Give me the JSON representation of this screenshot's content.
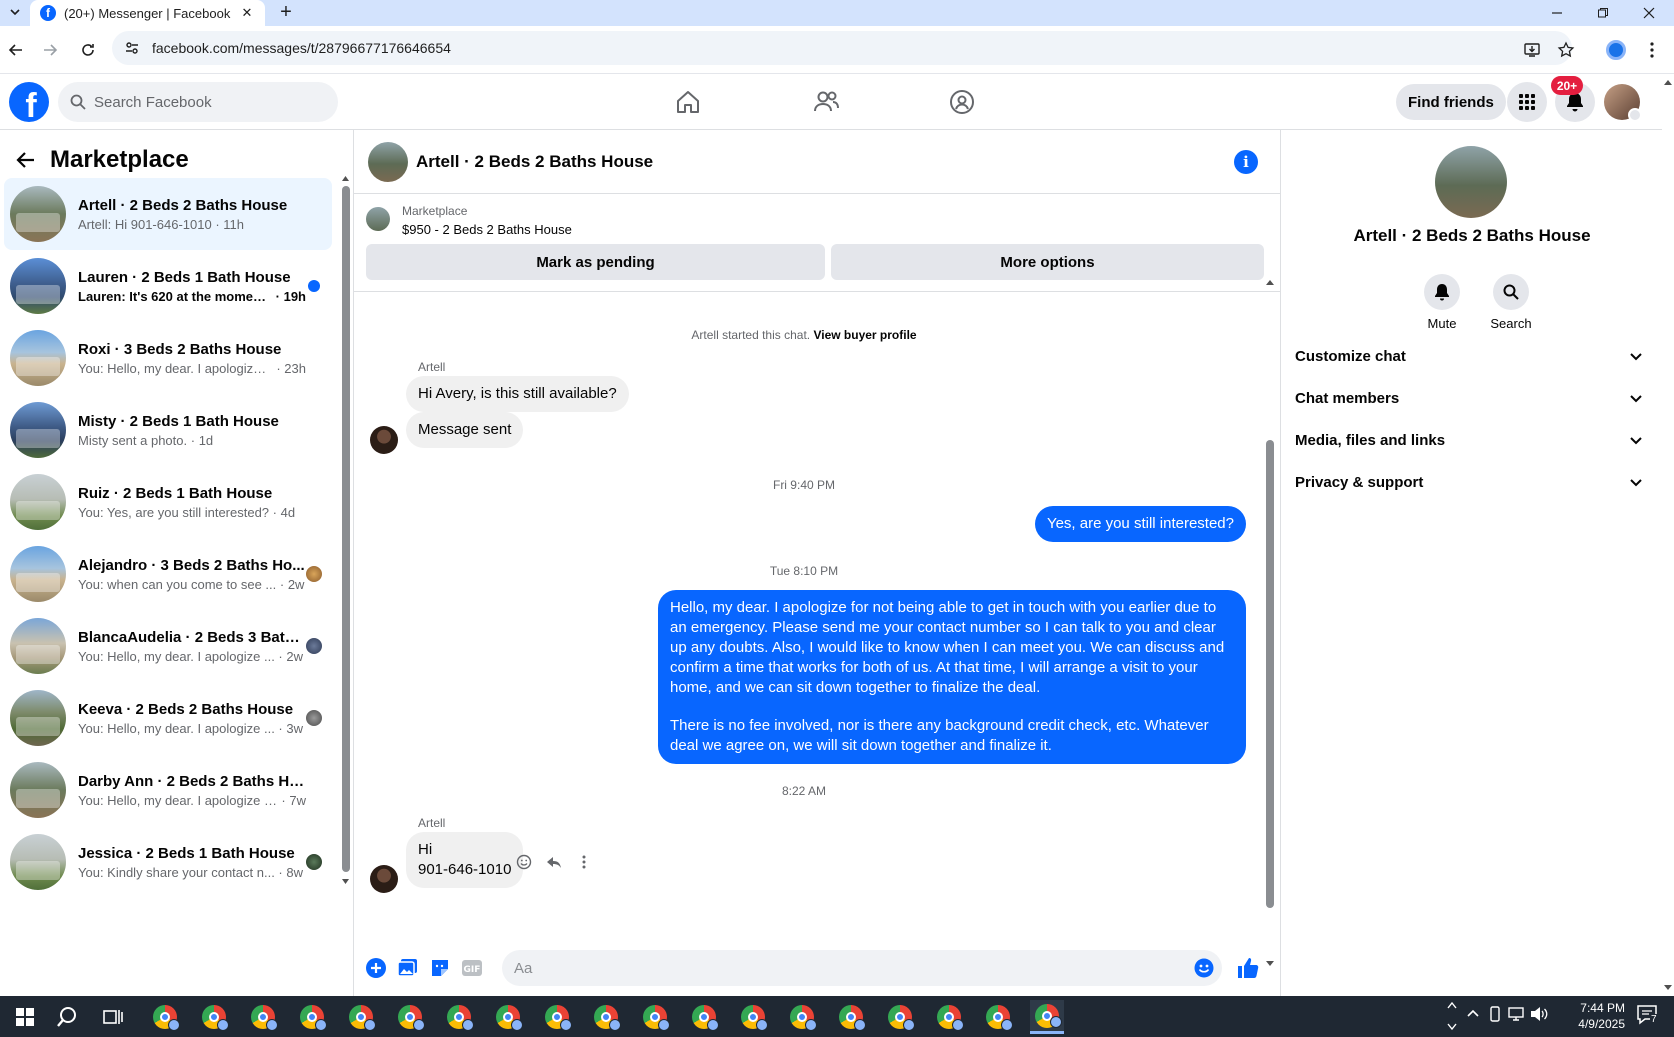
{
  "browser": {
    "tab_title": "(20+) Messenger | Facebook",
    "url": "facebook.com/messages/t/28796677176646654"
  },
  "header": {
    "search_placeholder": "Search Facebook",
    "find_friends": "Find friends",
    "notification_badge": "20+"
  },
  "sidebar": {
    "title": "Marketplace",
    "conversations": [
      {
        "name": "Artell · 2 Beds 2 Baths House",
        "preview": "Artell: Hi 901-646-1010",
        "time": "11h",
        "active": true
      },
      {
        "name": "Lauren · 2 Beds 1 Bath House",
        "preview": "Lauren: It's 620 at the moment....",
        "time": "19h",
        "unread": true
      },
      {
        "name": "Roxi · 3 Beds 2 Baths House",
        "preview": "You: Hello, my dear. I apologize fo...",
        "time": "23h"
      },
      {
        "name": "Misty · 2 Beds 1 Bath House",
        "preview": "Misty sent a photo.",
        "time": "1d"
      },
      {
        "name": "Ruiz · 2 Beds 1 Bath House",
        "preview": "You: Yes, are you still interested?",
        "time": "4d"
      },
      {
        "name": "Alejandro · 3 Beds 2 Baths Ho...",
        "preview": "You: when can you come to see ...",
        "time": "2w"
      },
      {
        "name": "BlancaAudelia · 2 Beds 3 Bath...",
        "preview": "You: Hello, my dear. I apologize ...",
        "time": "2w"
      },
      {
        "name": "Keeva · 2 Beds 2 Baths House",
        "preview": "You: Hello, my dear. I apologize ...",
        "time": "3w"
      },
      {
        "name": "Darby Ann · 2 Beds 2 Baths House",
        "preview": "You: Hello, my dear. I apologize for...",
        "time": "7w"
      },
      {
        "name": "Jessica · 2 Beds 1 Bath House",
        "preview": "You: Kindly share your contact n...",
        "time": "8w"
      }
    ]
  },
  "chat": {
    "title": "Artell · 2 Beds 2 Baths House",
    "listing_source": "Marketplace",
    "listing_price": "$950 - 2 Beds 2 Baths House",
    "mark_pending": "Mark as pending",
    "more_options": "More options",
    "started_text": "Artell started this chat.",
    "view_profile": "View buyer profile",
    "sender_name": "Artell",
    "msg1": "Hi Avery, is this still available?",
    "msg2": "Message sent",
    "ts1": "Fri 9:40 PM",
    "msg3": "Yes, are you still interested?",
    "ts2": "Tue 8:10 PM",
    "msg4_p1": "Hello, my dear. I apologize for not being able to get in touch with you earlier due to an emergency. Please send me your contact number so I can talk to you and clear up any doubts. Also, I would like to know when I can meet you. We can discuss and confirm a time that works for both of us. At that time, I will arrange a visit to your home, and we can sit down together to finalize the deal.",
    "msg4_p2": "There is no fee involved, nor is there any background credit check, etc. Whatever deal we agree on, we will sit down together and finalize it.",
    "ts3": "8:22 AM",
    "msg5_line1": "Hi",
    "msg5_line2": "901-646-1010",
    "composer_placeholder": "Aa"
  },
  "rightpanel": {
    "name": "Artell · 2 Beds 2 Baths House",
    "mute": "Mute",
    "search": "Search",
    "sections": [
      "Customize chat",
      "Chat members",
      "Media, files and links",
      "Privacy & support"
    ]
  },
  "taskbar": {
    "time": "7:44 PM",
    "date": "4/9/2025",
    "notif_count": "7"
  },
  "colors": {
    "fb_blue": "#0866ff",
    "active_bg": "#ebf5ff"
  }
}
